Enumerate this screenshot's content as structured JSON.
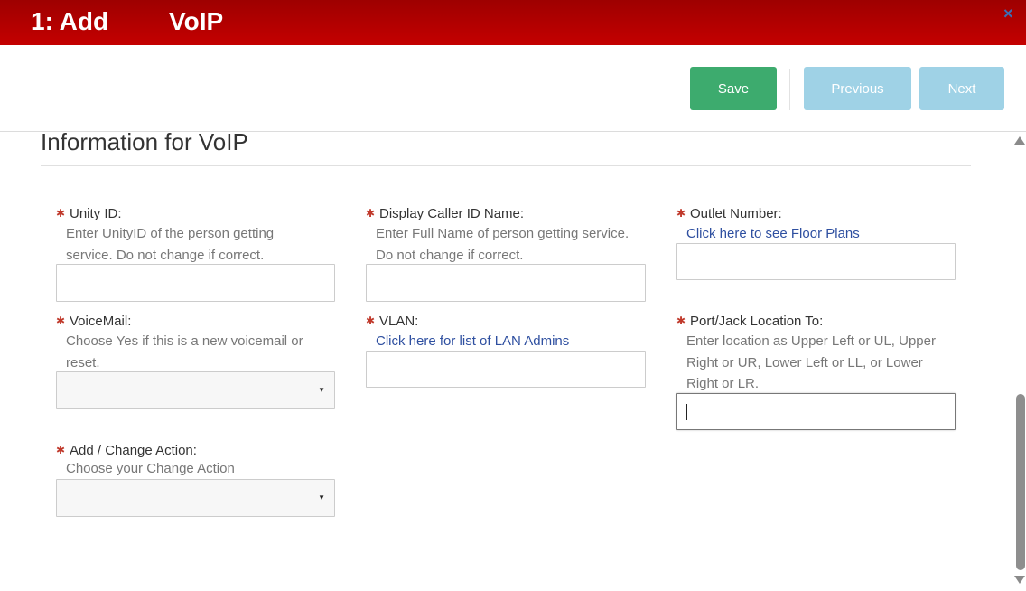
{
  "header": {
    "step": "1: Add",
    "title": "VoIP",
    "close": "×"
  },
  "toolbar": {
    "save_label": "Save",
    "previous_label": "Previous",
    "next_label": "Next"
  },
  "section": {
    "title": "Information for VoIP"
  },
  "colors": {
    "header_red": "#c40000",
    "save_green": "#3dab6e",
    "nav_disabled_blue": "#9fd2e6",
    "link_blue": "#2e4fa0",
    "required_red": "#c0392b"
  },
  "fields": {
    "unity_id": {
      "label": "Unity ID:",
      "help_line1": "Enter UnityID of the person getting",
      "help_line2": "service. Do not change if correct.",
      "value": ""
    },
    "display_caller_id": {
      "label": "Display Caller ID Name:",
      "help_line1": "Enter Full Name of person getting service.",
      "help_line2": "Do not change if correct.",
      "value": ""
    },
    "outlet_number": {
      "label": "Outlet Number:",
      "link": "Click here to see Floor Plans",
      "value": ""
    },
    "voicemail": {
      "label": "VoiceMail:",
      "help_line1": "Choose Yes if this is a new voicemail or",
      "help_line2": "reset.",
      "selected": ""
    },
    "vlan": {
      "label": "VLAN:",
      "link": "Click here for list of LAN Admins",
      "value": ""
    },
    "port_jack": {
      "label": "Port/Jack Location To:",
      "help_line1": "Enter location as Upper Left or UL, Upper",
      "help_line2": "Right or UR, Lower Left or LL, or Lower",
      "help_line3": "Right or LR.",
      "value": ""
    },
    "change_action": {
      "label": "Add / Change Action:",
      "help_line1": "Choose your Change Action",
      "selected": ""
    }
  },
  "icons": {
    "required": "required-asterisk-icon",
    "dropdown": "caret-down-icon",
    "close": "close-icon"
  }
}
